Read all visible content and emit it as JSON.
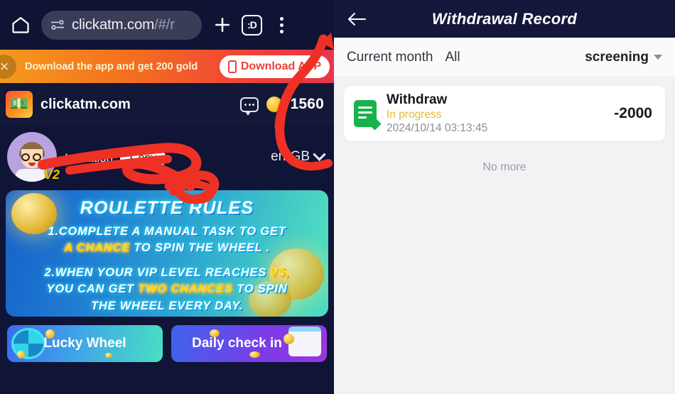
{
  "browser": {
    "home_icon": "home-icon",
    "url": "clickatm.com",
    "url_path": "/#/r",
    "new_tab_icon": "plus-icon",
    "tab_badge_label": ":D",
    "menu_icon": "kebab-menu-icon"
  },
  "download_banner": {
    "close_label": "×",
    "message": "Download the app and get 200 gold",
    "button_label": "Download APP",
    "phone_icon": "phone-icon"
  },
  "site_header": {
    "logo_icon": "money-stack-icon",
    "site_name": "clickatm.com",
    "chat_icon": "chat-bubble-icon",
    "coin_icon": "gold-coin-icon",
    "coin_count": "1560"
  },
  "profile": {
    "avatar_icon": "user-avatar",
    "vip_badge": "V2",
    "user_name": "",
    "invitation_label": "Invitation",
    "copy_button": "Copy",
    "language": "en-GB",
    "language_chevron": "chevron-down-icon"
  },
  "rules_banner": {
    "title": "ROULETTE RULES",
    "line1a": "1.COMPLETE A MANUAL TASK TO GET",
    "line1b_pre": "",
    "line1b_hl1": "A CHANCE",
    "line1b_post": " TO SPIN THE WHEEL .",
    "line2a_pre": "2.WHEN YOUR VIP LEVEL REACHES ",
    "line2a_hl": "V5,",
    "line2b_pre": "YOU CAN GET ",
    "line2b_hl": "TWO CHANCES",
    "line2b_post": " TO SPIN",
    "line2c": "THE WHEEL EVERY DAY."
  },
  "bottom_buttons": [
    {
      "label": "Lucky Wheel",
      "icon": "lucky-wheel-icon"
    },
    {
      "label": "Daily check in",
      "icon": "calendar-icon"
    }
  ],
  "withdrawal_record": {
    "back_icon": "back-arrow-icon",
    "title": "Withdrawal Record",
    "filters": {
      "month": "Current month",
      "type": "All",
      "screening": "screening",
      "screening_chevron": "triangle-down-icon"
    },
    "records": [
      {
        "icon": "document-edit-icon",
        "title": "Withdraw",
        "status": "In progress",
        "date": "2024/10/14 03:13:45",
        "amount": "-2000"
      }
    ],
    "footer": "No more"
  },
  "colors": {
    "page_dark": "#101436",
    "banner_orange": "#f4701f",
    "banner_red": "#e8354d",
    "accent_cyan": "#2ad6ff",
    "highlight_yellow": "#ffd400",
    "status_yellow": "#e6b92e",
    "record_green": "#17b24b",
    "panel_bg": "#f2f2f4",
    "annotation_red": "#ee3124"
  }
}
